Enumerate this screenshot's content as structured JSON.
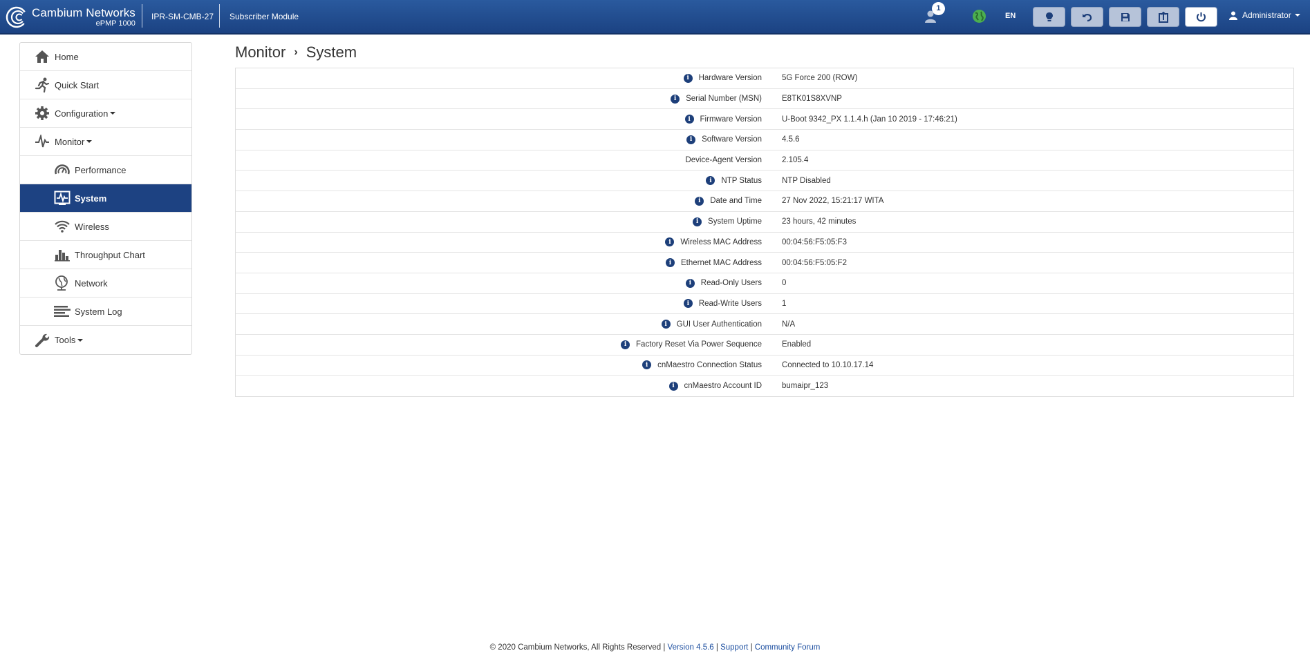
{
  "header": {
    "brand_name": "Cambium Networks",
    "brand_sub": "ePMP 1000",
    "device_name": "IPR-SM-CMB-27",
    "device_mode": "Subscriber Module",
    "notification_count": "1",
    "language": "EN",
    "user": "Administrator",
    "accent_color": "#1d4282"
  },
  "sidebar": {
    "items": [
      {
        "label": "Home",
        "icon": "home-icon"
      },
      {
        "label": "Quick Start",
        "icon": "running-person-icon"
      },
      {
        "label": "Configuration",
        "icon": "gear-icon"
      },
      {
        "label": "Monitor",
        "icon": "pulse-icon"
      },
      {
        "label": "Performance",
        "icon": "gauge-icon"
      },
      {
        "label": "System",
        "icon": "system-monitor-icon"
      },
      {
        "label": "Wireless",
        "icon": "wifi-icon"
      },
      {
        "label": "Throughput Chart",
        "icon": "bar-chart-icon"
      },
      {
        "label": "Network",
        "icon": "globe-network-icon"
      },
      {
        "label": "System Log",
        "icon": "log-lines-icon"
      },
      {
        "label": "Tools",
        "icon": "wrench-icon"
      }
    ]
  },
  "breadcrumb": {
    "parent": "Monitor",
    "current": "System"
  },
  "system_info": [
    {
      "label": "Hardware Version",
      "value": "5G Force 200 (ROW)",
      "info": true
    },
    {
      "label": "Serial Number (MSN)",
      "value": "E8TK01S8XVNP",
      "info": true
    },
    {
      "label": "Firmware Version",
      "value": "U-Boot 9342_PX 1.1.4.h (Jan 10 2019 - 17:46:21)",
      "info": true
    },
    {
      "label": "Software Version",
      "value": "4.5.6",
      "info": true
    },
    {
      "label": "Device-Agent Version",
      "value": "2.105.4",
      "info": false
    },
    {
      "label": "NTP Status",
      "value": "NTP Disabled",
      "info": true
    },
    {
      "label": "Date and Time",
      "value": "27 Nov 2022, 15:21:17 WITA",
      "info": true
    },
    {
      "label": "System Uptime",
      "value": "23 hours, 42 minutes",
      "info": true
    },
    {
      "label": "Wireless MAC Address",
      "value": "00:04:56:F5:05:F3",
      "info": true
    },
    {
      "label": "Ethernet MAC Address",
      "value": "00:04:56:F5:05:F2",
      "info": true
    },
    {
      "label": "Read-Only Users",
      "value": "0",
      "info": true
    },
    {
      "label": "Read-Write Users",
      "value": "1",
      "info": true
    },
    {
      "label": "GUI User Authentication",
      "value": "N/A",
      "info": true
    },
    {
      "label": "Factory Reset Via Power Sequence",
      "value": "Enabled",
      "info": true
    },
    {
      "label": "cnMaestro Connection Status",
      "value": "Connected to 10.10.17.14",
      "info": true
    },
    {
      "label": "cnMaestro Account ID",
      "value": "bumaipr_123",
      "info": true
    }
  ],
  "footer": {
    "copyright": "© 2020 Cambium Networks, All Rights Reserved",
    "version": "Version 4.5.6",
    "support": "Support",
    "forum": "Community Forum",
    "sep": "|"
  }
}
